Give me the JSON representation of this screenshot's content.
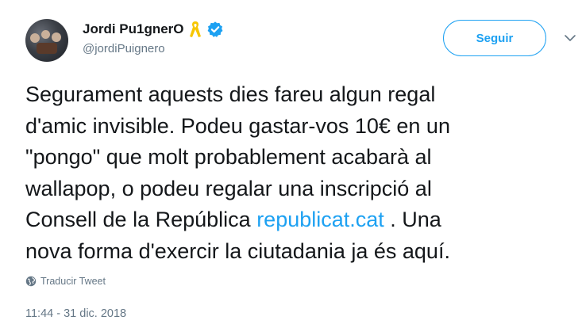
{
  "header": {
    "display_name": "Jordi Pu1gnerO",
    "handle": "@jordiPuignero",
    "follow_label": "Seguir"
  },
  "icons": {
    "ribbon": "yellow-ribbon-icon",
    "verified": "verified-badge-icon",
    "caret": "chevron-down-icon",
    "globe": "globe-icon"
  },
  "colors": {
    "accent": "#1da1f2",
    "ribbon": "#f7c600",
    "secondary_text": "#657786",
    "text": "#14171a"
  },
  "tweet": {
    "text_part1": "Segurament aquests dies fareu algun regal\nd'amic invisible. Podeu gastar-vos 10€ en un\n\"pongo\" que molt probablement acabarà al\nwallapop, o podeu regalar una inscripció al\nConsell de la República ",
    "link": "republicat.cat",
    "text_part2": " . Una\nnova forma d'exercir la ciutadania ja és aquí.",
    "translate_label": "Traducir Tweet",
    "timestamp": "11:44 - 31 dic. 2018"
  }
}
